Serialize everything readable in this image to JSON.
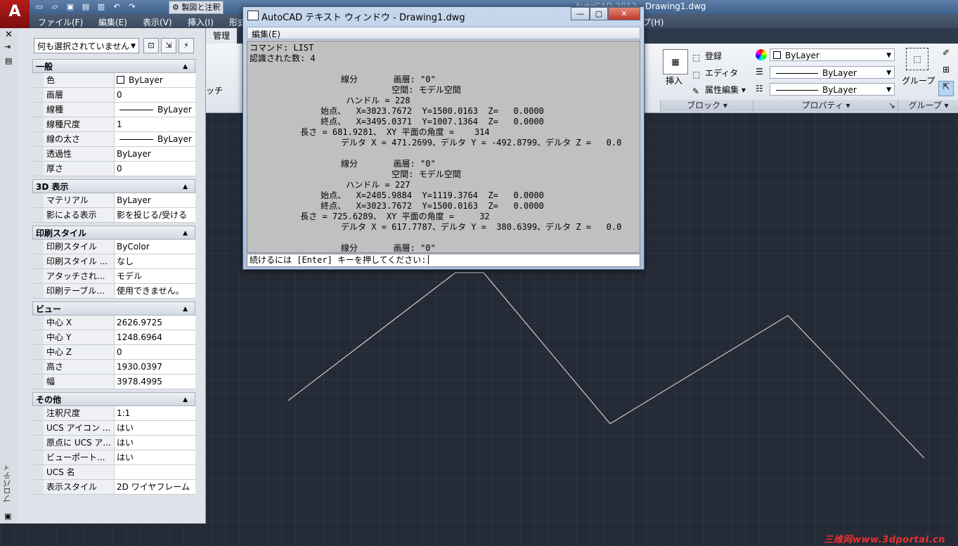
{
  "window": {
    "title_ghost": "AutoCAD 2012",
    "title": "Drawing1.dwg",
    "workspace": "製図と注釈"
  },
  "menubar": [
    "ファイル(F)",
    "編集(E)",
    "表示(V)",
    "挿入(I)",
    "形式",
    "プ(H)"
  ],
  "ribbon": {
    "active_tab": "管理",
    "partial_label": "ッチ",
    "block_panel": {
      "insert_label": "挿入",
      "register_label": "登録",
      "editor_label": "エディタ",
      "attr_edit_label": "属性編集",
      "footer": "ブロック"
    },
    "properties_panel": {
      "color_combo": "ByLayer",
      "linetype_combo": "ByLayer",
      "lineweight_combo": "ByLayer",
      "footer": "プロパティ"
    },
    "group_panel": {
      "group_label": "グループ",
      "footer": "グループ"
    }
  },
  "properties": {
    "vertical_title": "プロパティ",
    "selection": "何も選択されていません",
    "sections": [
      {
        "title": "一般",
        "rows": [
          {
            "name": "色",
            "value": "ByLayer",
            "swatch": true
          },
          {
            "name": "画層",
            "value": "0"
          },
          {
            "name": "線種",
            "value": "ByLayer",
            "line": true
          },
          {
            "name": "線種尺度",
            "value": "1"
          },
          {
            "name": "線の太さ",
            "value": "ByLayer",
            "line": true
          },
          {
            "name": "透過性",
            "value": "ByLayer"
          },
          {
            "name": "厚さ",
            "value": "0"
          }
        ]
      },
      {
        "title": "3D 表示",
        "rows": [
          {
            "name": "マテリアル",
            "value": "ByLayer"
          },
          {
            "name": "影による表示",
            "value": "影を投じる/受ける"
          }
        ]
      },
      {
        "title": "印刷スタイル",
        "rows": [
          {
            "name": "印刷スタイル",
            "value": "ByColor"
          },
          {
            "name": "印刷スタイル ...",
            "value": "なし"
          },
          {
            "name": "アタッチされ...",
            "value": "モデル"
          },
          {
            "name": "印刷テーブル...",
            "value": "使用できません。"
          }
        ]
      },
      {
        "title": "ビュー",
        "rows": [
          {
            "name": "中心 X",
            "value": "2626.9725"
          },
          {
            "name": "中心 Y",
            "value": "1248.6964"
          },
          {
            "name": "中心 Z",
            "value": "0"
          },
          {
            "name": "高さ",
            "value": "1930.0397"
          },
          {
            "name": "幅",
            "value": "3978.4995"
          }
        ]
      },
      {
        "title": "その他",
        "rows": [
          {
            "name": "注釈尺度",
            "value": "1:1"
          },
          {
            "name": "UCS アイコン ...",
            "value": "はい"
          },
          {
            "name": "原点に UCS ア...",
            "value": "はい"
          },
          {
            "name": "ビューポート...",
            "value": "はい"
          },
          {
            "name": "UCS 名",
            "value": ""
          },
          {
            "name": "表示スタイル",
            "value": "2D ワイヤフレーム"
          }
        ]
      }
    ]
  },
  "text_window": {
    "title": "AutoCAD テキスト ウィンドウ - Drawing1.dwg",
    "menu_edit": "編集(E)",
    "output_lines": [
      "コマンド: LIST",
      "認識された数: 4",
      "",
      "                  線分       画層: \"0\"",
      "                            空間: モデル空間",
      "                   ハンドル = 228",
      "              始点、  X=3023.7672  Y=1500.0163  Z=   0.0000",
      "              終点、  X=3495.0371  Y=1007.1364  Z=   0.0000",
      "          長さ = 681.9281、 XY 平面の角度 =    314",
      "                  デルタ X = 471.2699、デルタ Y = -492.8799、デルタ Z =   0.0",
      "",
      "                  線分       画層: \"0\"",
      "                            空間: モデル空間",
      "                   ハンドル = 227",
      "              始点、  X=2405.9884  Y=1119.3764  Z=   0.0000",
      "              終点、  X=3023.7672  Y=1500.0163  Z=   0.0000",
      "          長さ = 725.6289、 XY 平面の角度 =     32",
      "                  デルタ X = 617.7787、デルタ Y =  380.6399、デルタ Z =   0.0",
      "",
      "                  線分       画層: \"0\""
    ],
    "prompt": "続けるには [Enter] キーを押してください:"
  },
  "watermark": "三维网www.3dportal.cn",
  "colors": {
    "canvas_bg": "#252b36",
    "geometry": "#ffffff",
    "app_red": "#b51d1d"
  }
}
